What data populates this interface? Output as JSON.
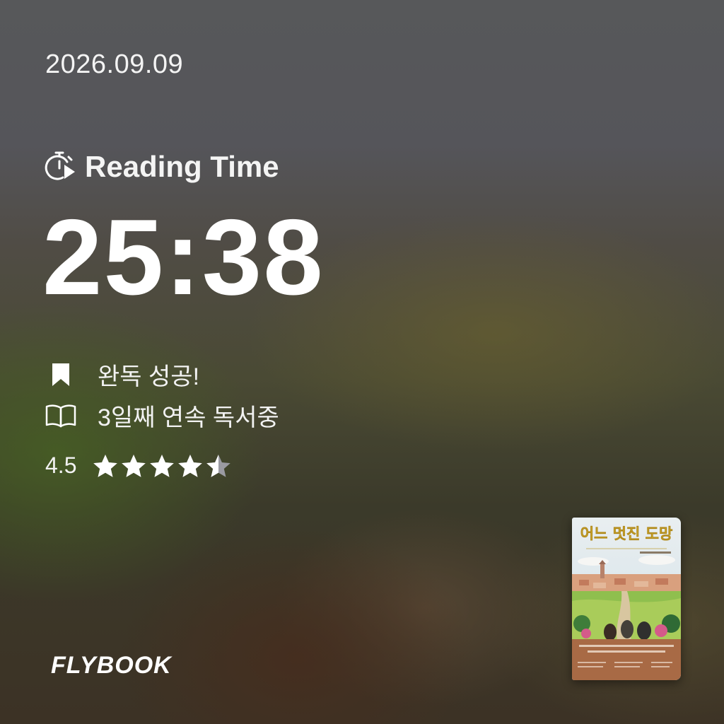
{
  "date": "2026.09.09",
  "reading_time": {
    "label": "Reading Time",
    "icon": "stopwatch-play-icon",
    "timer": "25:38"
  },
  "stats": [
    {
      "icon": "bookmark-icon",
      "text": "완독 성공!"
    },
    {
      "icon": "open-book-icon",
      "text": "3일째 연속 독서중"
    }
  ],
  "rating": {
    "value": "4.5",
    "stars": 4.5,
    "max": 5
  },
  "brand": "FLYBOOK",
  "book_cover": {
    "title": "어느 멋진 도망"
  },
  "colors": {
    "text": "#ffffff",
    "star_filled": "#ffffff",
    "star_empty": "#9a9aa2",
    "cover_title": "#e9c53c"
  }
}
